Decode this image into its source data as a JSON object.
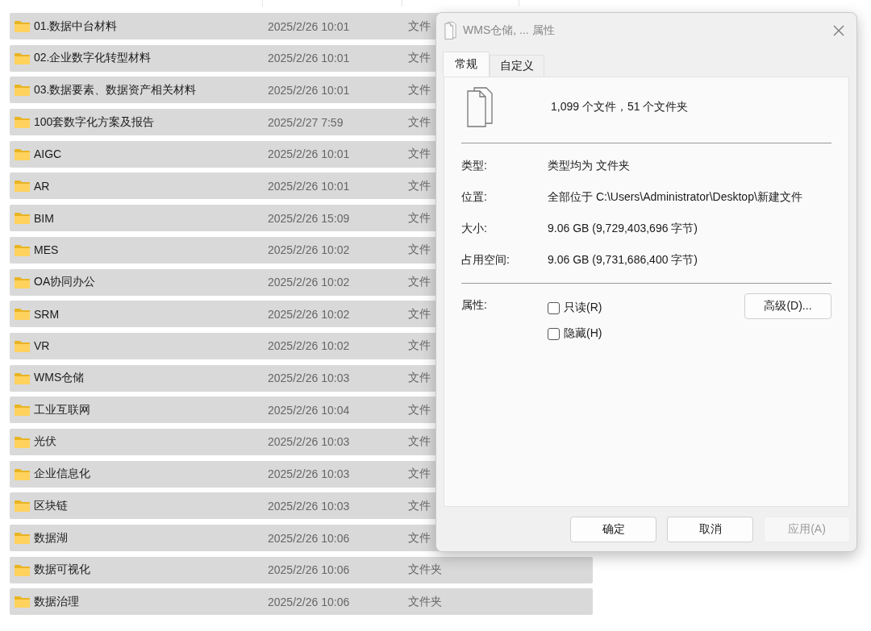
{
  "file_list": {
    "rows": [
      {
        "name": "01.数据中台材料",
        "modified": "2025/2/26 10:01",
        "type": "文件"
      },
      {
        "name": "02.企业数字化转型材料",
        "modified": "2025/2/26 10:01",
        "type": "文件"
      },
      {
        "name": "03.数据要素、数据资产相关材料",
        "modified": "2025/2/26 10:01",
        "type": "文件"
      },
      {
        "name": "100套数字化方案及报告",
        "modified": "2025/2/27 7:59",
        "type": "文件"
      },
      {
        "name": "AIGC",
        "modified": "2025/2/26 10:01",
        "type": "文件"
      },
      {
        "name": "AR",
        "modified": "2025/2/26 10:01",
        "type": "文件"
      },
      {
        "name": "BIM",
        "modified": "2025/2/26 15:09",
        "type": "文件"
      },
      {
        "name": "MES",
        "modified": "2025/2/26 10:02",
        "type": "文件"
      },
      {
        "name": "OA协同办公",
        "modified": "2025/2/26 10:02",
        "type": "文件"
      },
      {
        "name": "SRM",
        "modified": "2025/2/26 10:02",
        "type": "文件"
      },
      {
        "name": "VR",
        "modified": "2025/2/26 10:02",
        "type": "文件"
      },
      {
        "name": "WMS仓储",
        "modified": "2025/2/26 10:03",
        "type": "文件"
      },
      {
        "name": "工业互联网",
        "modified": "2025/2/26 10:04",
        "type": "文件"
      },
      {
        "name": "光伏",
        "modified": "2025/2/26 10:03",
        "type": "文件"
      },
      {
        "name": "企业信息化",
        "modified": "2025/2/26 10:03",
        "type": "文件"
      },
      {
        "name": "区块链",
        "modified": "2025/2/26 10:03",
        "type": "文件"
      },
      {
        "name": "数据湖",
        "modified": "2025/2/26 10:06",
        "type": "文件"
      },
      {
        "name": "数据可视化",
        "modified": "2025/2/26 10:06",
        "type": "文件夹"
      },
      {
        "name": "数据治理",
        "modified": "2025/2/26 10:06",
        "type": "文件夹"
      }
    ]
  },
  "dialog": {
    "title": "WMS仓储, ... 属性",
    "tabs": [
      {
        "label": "常规",
        "selected": true
      },
      {
        "label": "自定义",
        "selected": false
      }
    ],
    "summary": "1,099 个文件，51 个文件夹",
    "details": [
      {
        "label": "类型:",
        "value": "类型均为 文件夹"
      },
      {
        "label": "位置:",
        "value": "全部位于 C:\\Users\\Administrator\\Desktop\\新建文件"
      },
      {
        "label": "大小:",
        "value": "9.06 GB (9,729,403,696 字节)"
      },
      {
        "label": "占用空间:",
        "value": "9.06 GB (9,731,686,400 字节)"
      }
    ],
    "attributes_label": "属性:",
    "attributes": [
      {
        "label": "只读(R)",
        "checked": false
      },
      {
        "label": "隐藏(H)",
        "checked": false
      }
    ],
    "advanced_button": "高级(D)...",
    "buttons": [
      {
        "label": "确定",
        "disabled": false
      },
      {
        "label": "取消",
        "disabled": false
      },
      {
        "label": "应用(A)",
        "disabled": true
      }
    ]
  }
}
